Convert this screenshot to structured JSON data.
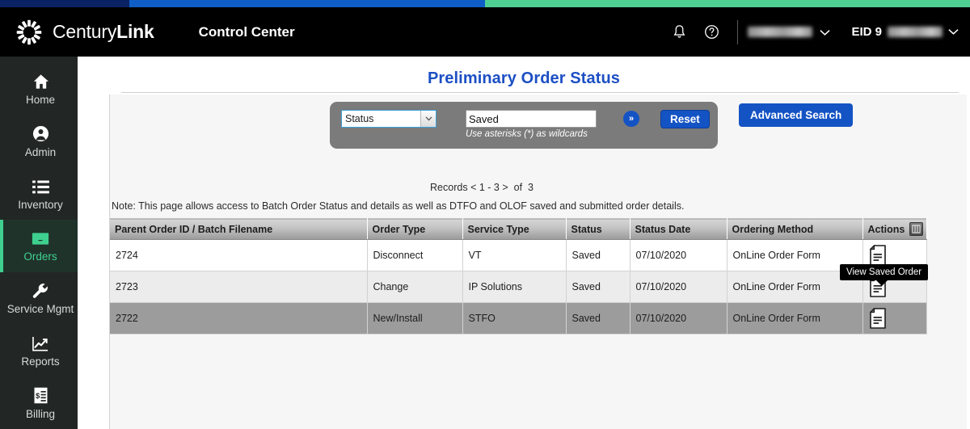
{
  "topstrip": {
    "navy": "#0b2265",
    "blue": "#0f5ec7",
    "green": "#4ed093"
  },
  "header": {
    "brand_light": "Century",
    "brand_bold": "Link",
    "app_name": "Control Center",
    "logo_icon": "centurylink-starburst-icon",
    "bell_icon": "notification-bell-icon",
    "help_icon": "help-circle-icon",
    "account_label": "",
    "eid_label": "EID 9",
    "account_chevron": "chevron-down-icon",
    "eid_chevron": "chevron-down-icon"
  },
  "sidebar": {
    "items": [
      {
        "label": "Home",
        "icon": "home-icon",
        "active": false
      },
      {
        "label": "Admin",
        "icon": "user-icon",
        "active": false
      },
      {
        "label": "Inventory",
        "icon": "list-icon",
        "active": false
      },
      {
        "label": "Orders",
        "icon": "inbox-icon",
        "active": true
      },
      {
        "label": "Service Mgmt",
        "icon": "wrench-icon",
        "active": false
      },
      {
        "label": "Reports",
        "icon": "chart-line-icon",
        "active": false
      },
      {
        "label": "Billing",
        "icon": "invoice-icon",
        "active": false
      }
    ],
    "active_color": "#3fd08f"
  },
  "main": {
    "page_title": "Preliminary Order Status",
    "title_color": "#1c4fc4"
  },
  "search": {
    "filter_selected": "Status",
    "filter_options": [
      "Status"
    ],
    "query_value": "Saved",
    "query_placeholder": "",
    "wildcard_hint": "Use asterisks (*) as wildcards",
    "go_label": "»",
    "go_icon": "double-chevron-right-icon",
    "reset_label": "Reset",
    "advanced_search_label": "Advanced Search",
    "accent_color": "#1453c4"
  },
  "records": {
    "prefix": "Records",
    "prev": "<",
    "range": "1 - 3",
    "next": ">",
    "of_label": "of",
    "total": "3",
    "note": "Note: This page allows access to Batch Order Status and details as well as DTFO and OLOF saved and submitted order details."
  },
  "table": {
    "columns": [
      "Parent Order ID / Batch Filename",
      "Order Type",
      "Service Type",
      "Status",
      "Status Date",
      "Ordering Method",
      "Actions"
    ],
    "settings_icon": "column-settings-icon",
    "row_action_icon": "saved-order-document-icon",
    "rows": [
      {
        "parent_order_id": "2724",
        "order_type": "Disconnect",
        "service_type": "VT",
        "status": "Saved",
        "status_date": "07/10/2020",
        "ordering_method": "OnLine Order Form",
        "state": "normal"
      },
      {
        "parent_order_id": "2723",
        "order_type": "Change",
        "service_type": "IP Solutions",
        "status": "Saved",
        "status_date": "07/10/2020",
        "ordering_method": "OnLine Order Form",
        "state": "alt"
      },
      {
        "parent_order_id": "2722",
        "order_type": "New/Install",
        "service_type": "STFO",
        "status": "Saved",
        "status_date": "07/10/2020",
        "ordering_method": "OnLine Order Form",
        "state": "hover"
      }
    ]
  },
  "tooltip": {
    "text": "View Saved Order"
  }
}
